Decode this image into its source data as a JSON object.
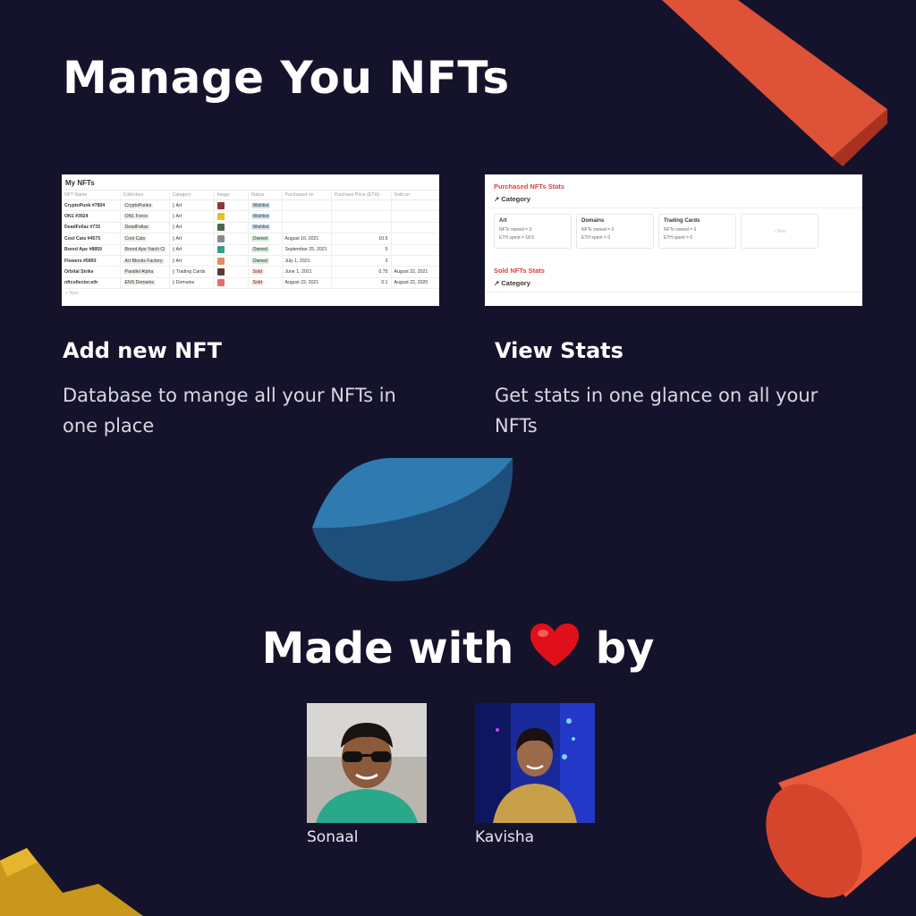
{
  "title": "Manage You NFTs",
  "table_panel": {
    "title": "My NFTs",
    "columns": [
      "NFT Name",
      "Collection",
      "Category",
      "Image",
      "Status",
      "Purchased on",
      "Purchase Price (ETH)",
      "Sold on"
    ],
    "rows": [
      {
        "name": "CryptoPunk #7804",
        "collection": "CryptoPunks",
        "category": "Art",
        "status": "Wishlist",
        "purchased": "",
        "price": "",
        "sold": "",
        "thumb": "#8b3a3a"
      },
      {
        "name": "ON1 #3924",
        "collection": "ON1 Force",
        "category": "Art",
        "status": "Wishlist",
        "purchased": "",
        "price": "",
        "sold": "",
        "thumb": "#e8c21a"
      },
      {
        "name": "DeadFellaz #735",
        "collection": "DeadFellaz",
        "category": "Art",
        "status": "Wishlist",
        "purchased": "",
        "price": "",
        "sold": "",
        "thumb": "#4a6a4a"
      },
      {
        "name": "Cool Cats #4575",
        "collection": "Cool Cats",
        "category": "Art",
        "status": "Owned",
        "purchased": "August 16, 2021",
        "price": "10.5",
        "sold": "",
        "thumb": "#8a8a8a"
      },
      {
        "name": "Bored Ape #8859",
        "collection": "Bored Ape Yatch Cl",
        "category": "Art",
        "status": "Owned",
        "purchased": "September 25, 2021",
        "price": "5",
        "sold": "",
        "thumb": "#2f9e8a"
      },
      {
        "name": "Flowers #5893",
        "collection": "Art Blocks Factory",
        "category": "Art",
        "status": "Owned",
        "purchased": "July 1, 2021",
        "price": "3",
        "sold": "",
        "thumb": "#e88a6a"
      },
      {
        "name": "Orbital Strike",
        "collection": "Parallel Alpha",
        "category": "Trading Cards",
        "status": "Sold",
        "purchased": "June 1, 2021",
        "price": "0.75",
        "sold": "August 22, 2021",
        "thumb": "#5a3a2a"
      },
      {
        "name": "nftcollector.eth",
        "collection": "ENS Domains",
        "category": "Domains",
        "status": "Sold",
        "purchased": "August 22, 2021",
        "price": "0.1",
        "sold": "August 22, 2020",
        "thumb": "#f06a6a"
      }
    ],
    "new_label": "+ New"
  },
  "stats_panel": {
    "purchased_heading": "Purchased NFTs Stats",
    "category_label": "↗ Category",
    "cards": [
      {
        "title": "Art",
        "line1": "NFTs owned = 3",
        "line2": "ETH spent = 18.5"
      },
      {
        "title": "Domains",
        "line1": "NFTs owned = 0",
        "line2": "ETH spent = 0"
      },
      {
        "title": "Trading Cards",
        "line1": "NFTs owned = 0",
        "line2": "ETH spent = 0"
      }
    ],
    "new_label": "+ New",
    "sold_heading": "Sold NFTs Stats",
    "sold_category_label": "↗ Category"
  },
  "features": [
    {
      "title": "Add new NFT",
      "desc": "Database to mange all your NFTs in one place"
    },
    {
      "title": "View Stats",
      "desc": "Get stats in one glance on all your NFTs"
    }
  ],
  "made_with": {
    "before": "Made with",
    "after": "by",
    "heart_icon": "heart-icon",
    "heart_color": "#e0101a"
  },
  "authors": [
    {
      "name": "Sonaal"
    },
    {
      "name": "Kavisha"
    }
  ],
  "colors": {
    "background": "#15132b",
    "accent_red": "#e0523a",
    "accent_blue": "#2f6a9a",
    "accent_gold": "#c99a1e"
  }
}
